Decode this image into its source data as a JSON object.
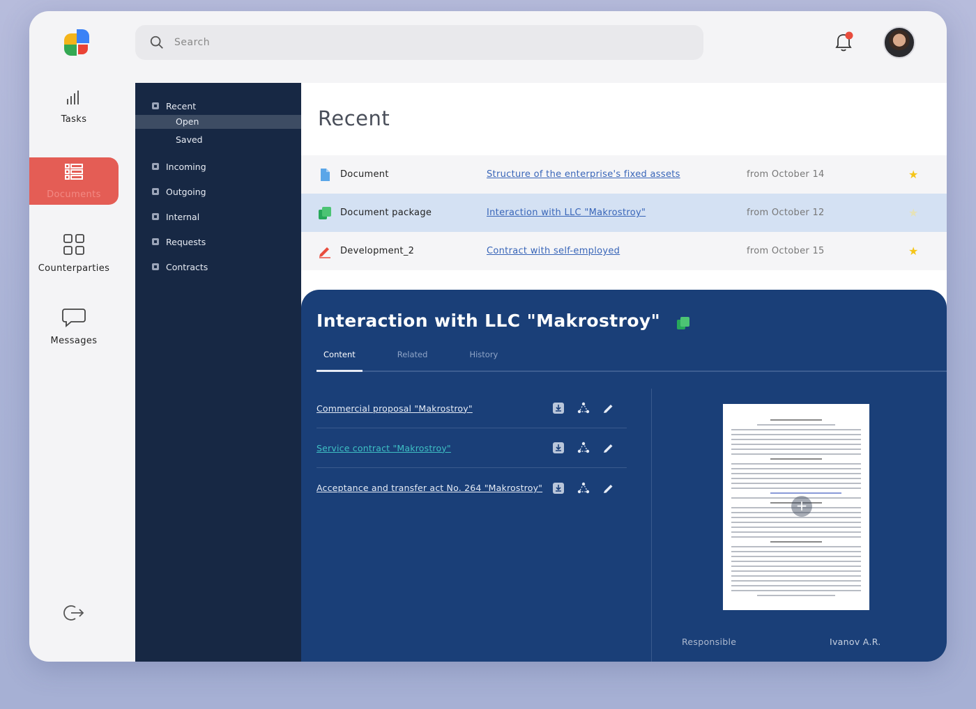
{
  "search": {
    "placeholder": "Search"
  },
  "nav": {
    "tasks": "Tasks",
    "documents": "Documents",
    "counterparties": "Counterparties",
    "messages": "Messages"
  },
  "folders": {
    "recent": "Recent",
    "open": "Open",
    "saved": "Saved",
    "incoming": "Incoming",
    "outgoing": "Outgoing",
    "internal": "Internal",
    "requests": "Requests",
    "contracts": "Contracts"
  },
  "main": {
    "title": "Recent",
    "rows": [
      {
        "type": "Document",
        "link": "Structure of the enterprise's fixed assets",
        "date": "from October 14",
        "starred": true
      },
      {
        "type": "Document package",
        "link": "Interaction with LLC \"Makrostroy\"",
        "date": "from October 12",
        "starred": false
      },
      {
        "type": "Development_2",
        "link": "Contract with self-employed",
        "date": "from October 15",
        "starred": true
      }
    ]
  },
  "detail": {
    "title": "Interaction with LLC \"Makrostroy\"",
    "tabs": [
      "Content",
      "Related",
      "History"
    ],
    "files": [
      "Commercial proposal \"Makrostroy\"",
      "Service contract \"Makrostroy\"",
      "Acceptance and transfer act No. 264 \"Makrostroy\""
    ],
    "responsible_label": "Responsible",
    "responsible_value": "Ivanov A.R."
  },
  "colors": {
    "accent": "#e45d55",
    "folder_bg": "#172844",
    "detail_bg": "#1a3f78",
    "link": "#3865b8",
    "star": "#f5c518"
  }
}
